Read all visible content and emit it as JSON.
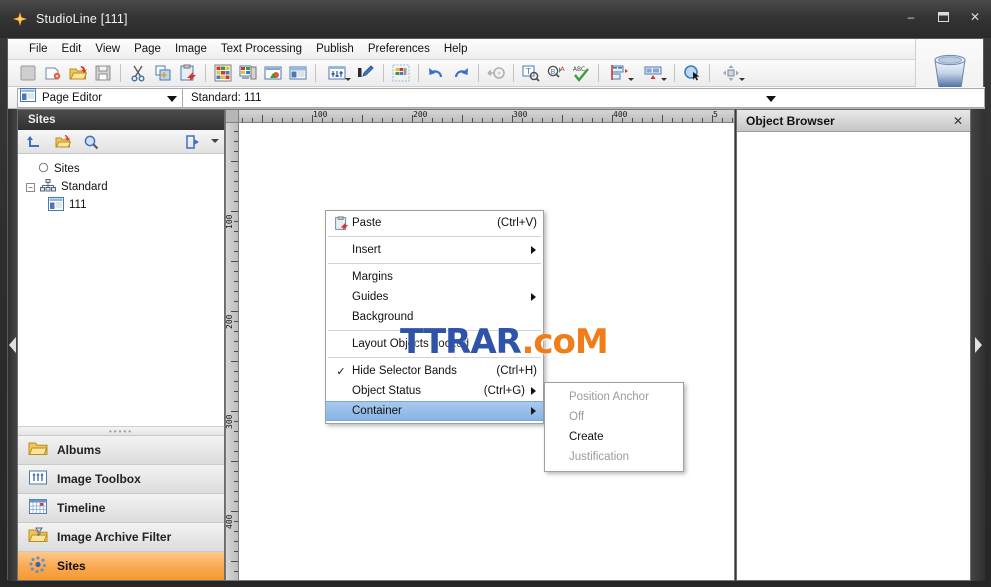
{
  "window": {
    "title": "StudioLine [111]",
    "app_icon": "star-icon",
    "minimize": "–",
    "maximize": "❐",
    "close": "✕"
  },
  "menubar": {
    "items": [
      {
        "label": "File"
      },
      {
        "label": "Edit"
      },
      {
        "label": "View"
      },
      {
        "label": "Page"
      },
      {
        "label": "Image"
      },
      {
        "label": "Text Processing"
      },
      {
        "label": "Publish"
      },
      {
        "label": "Preferences"
      },
      {
        "label": "Help"
      }
    ]
  },
  "toolbar": {
    "buttons": [
      {
        "name": "new-page-icon",
        "glyph": ""
      },
      {
        "name": "new-document-icon",
        "glyph": ""
      },
      {
        "name": "open-folder-icon",
        "glyph": ""
      },
      {
        "name": "save-icon",
        "glyph": ""
      },
      {
        "name": "cut-icon",
        "glyph": ""
      },
      {
        "name": "copy-icon",
        "glyph": ""
      },
      {
        "name": "paste-icon",
        "glyph": ""
      },
      {
        "name": "layout-grid-icon",
        "glyph": ""
      },
      {
        "name": "page-preview-icon",
        "glyph": ""
      },
      {
        "name": "image-properties-icon",
        "glyph": ""
      },
      {
        "name": "page-editor-icon",
        "glyph": ""
      },
      {
        "name": "adjust-sliders-icon",
        "glyph": ""
      },
      {
        "name": "eyedropper-icon",
        "glyph": ""
      },
      {
        "name": "palette-icon",
        "glyph": ""
      },
      {
        "name": "undo-icon",
        "glyph": ""
      },
      {
        "name": "redo-icon",
        "glyph": ""
      },
      {
        "name": "burn-disc-icon",
        "glyph": ""
      },
      {
        "name": "text-search-icon",
        "glyph": ""
      },
      {
        "name": "find-replace-icon",
        "glyph": ""
      },
      {
        "name": "spellcheck-icon",
        "glyph": ""
      },
      {
        "name": "align-left-icon",
        "glyph": ""
      },
      {
        "name": "align-center-icon",
        "glyph": ""
      },
      {
        "name": "select-object-icon",
        "glyph": ""
      },
      {
        "name": "move-object-icon",
        "glyph": ""
      }
    ]
  },
  "selectorbar": {
    "mode_value": "Page Editor",
    "mode_icon": "page-editor-icon",
    "page_value": "Standard: 111"
  },
  "trash": {
    "name": "recycle-bin-icon"
  },
  "sites_panel": {
    "title": "Sites",
    "tools": [
      {
        "name": "go-up-icon"
      },
      {
        "name": "new-folder-icon"
      },
      {
        "name": "search-icon"
      },
      {
        "name": "export-icon"
      }
    ],
    "tree": [
      {
        "label": "Sites",
        "icon": "circle-icon",
        "level": 0,
        "expander": ""
      },
      {
        "label": "Standard",
        "icon": "sitemap-icon",
        "level": 0,
        "expander": "−"
      },
      {
        "label": "111",
        "icon": "page-icon",
        "level": 1,
        "expander": ""
      }
    ]
  },
  "dock_buttons": [
    {
      "label": "Albums",
      "icon": "folder-icon",
      "active": false
    },
    {
      "label": "Image Toolbox",
      "icon": "toolbox-icon",
      "active": false
    },
    {
      "label": "Timeline",
      "icon": "calendar-icon",
      "active": false
    },
    {
      "label": "Image Archive Filter",
      "icon": "filter-folder-icon",
      "active": false
    },
    {
      "label": "Sites",
      "icon": "sites-icon",
      "active": true
    }
  ],
  "canvas": {
    "ruler_h_labels": [
      "100",
      "200",
      "300",
      "400",
      "5"
    ],
    "ruler_v_labels": [
      "100",
      "200",
      "300",
      "400"
    ],
    "ruler_unit_step": 100
  },
  "object_browser": {
    "title": "Object Browser",
    "close_label": "✕"
  },
  "context_menu": {
    "items": [
      {
        "label": "Paste",
        "accel": "(Ctrl+V)",
        "icon": "paste-icon",
        "checked": false,
        "submenu": false,
        "selected": false,
        "separator_after": true
      },
      {
        "label": "Insert",
        "accel": "",
        "icon": "",
        "checked": false,
        "submenu": true,
        "selected": false,
        "separator_after": true
      },
      {
        "label": "Margins",
        "accel": "",
        "icon": "",
        "checked": false,
        "submenu": false,
        "selected": false,
        "separator_after": false
      },
      {
        "label": "Guides",
        "accel": "",
        "icon": "",
        "checked": false,
        "submenu": true,
        "selected": false,
        "separator_after": false
      },
      {
        "label": "Background",
        "accel": "",
        "icon": "",
        "checked": false,
        "submenu": false,
        "selected": false,
        "separator_after": true
      },
      {
        "label": "Layout Objects Locked",
        "accel": "",
        "icon": "",
        "checked": false,
        "submenu": false,
        "selected": false,
        "separator_after": true
      },
      {
        "label": "Hide Selector Bands",
        "accel": "(Ctrl+H)",
        "icon": "",
        "checked": true,
        "submenu": false,
        "selected": false,
        "separator_after": false
      },
      {
        "label": "Object Status",
        "accel": "(Ctrl+G)",
        "icon": "",
        "checked": false,
        "submenu": true,
        "selected": false,
        "separator_after": false
      },
      {
        "label": "Container",
        "accel": "",
        "icon": "",
        "checked": false,
        "submenu": true,
        "selected": true,
        "separator_after": false
      }
    ]
  },
  "submenu": {
    "items": [
      {
        "label": "Position Anchor",
        "enabled": false
      },
      {
        "label": "Off",
        "enabled": false
      },
      {
        "label": "Create",
        "enabled": true
      },
      {
        "label": "Justification",
        "enabled": false
      }
    ]
  },
  "watermark": {
    "part1": "TTRAR",
    "part2": ".coM"
  },
  "colors": {
    "accent_orange": "#f59a32",
    "menu_highlight": "#87b4e4",
    "title_bar": "#333333",
    "watermark_blue": "#2e53a8",
    "watermark_orange": "#f07d1a"
  }
}
